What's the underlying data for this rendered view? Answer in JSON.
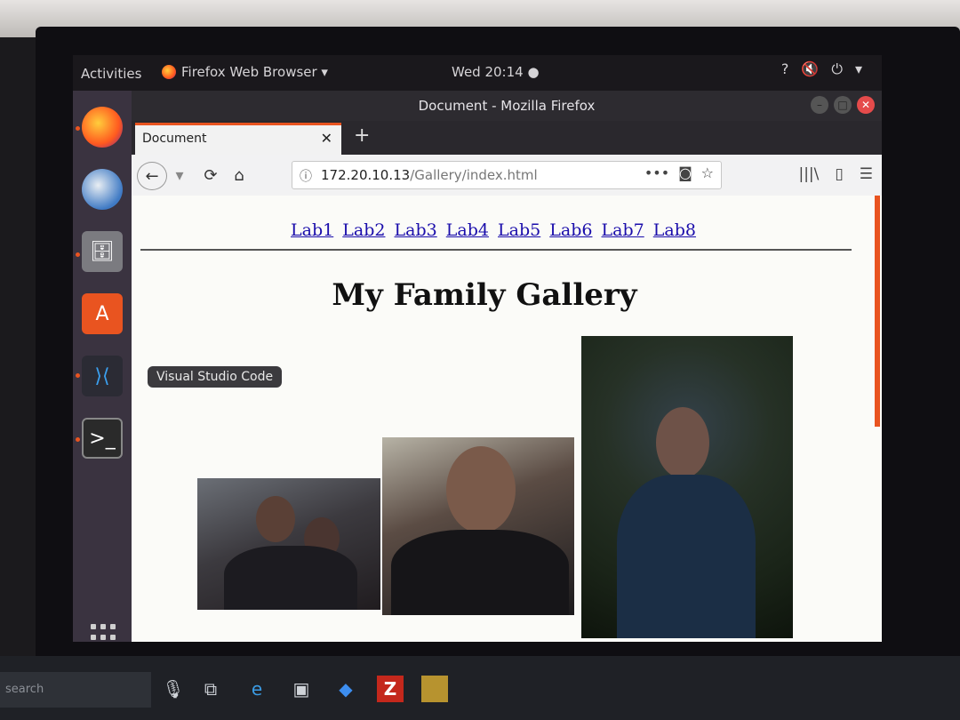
{
  "ubuntu": {
    "activities": "Activities",
    "app_menu": "Firefox Web Browser ▾",
    "clock": "Wed 20:14 ●",
    "dock_tooltip": "Visual Studio Code"
  },
  "window": {
    "title": "Document - Mozilla Firefox"
  },
  "tab": {
    "title": "Document",
    "close": "✕",
    "new_tab": "+"
  },
  "urlbar": {
    "host": "172.20.10.13",
    "path": "/Gallery/index.html",
    "more": "•••"
  },
  "page": {
    "nav_links": [
      "Lab1",
      "Lab2",
      "Lab3",
      "Lab4",
      "Lab5",
      "Lab6",
      "Lab7",
      "Lab8"
    ],
    "title": "My Family Gallery"
  },
  "host_taskbar": {
    "search": "search"
  },
  "icons": {
    "back": "back-arrow-icon",
    "reload": "reload-icon",
    "home": "home-icon",
    "pocket": "pocket-icon",
    "bookmark": "star-icon",
    "library": "library-icon",
    "sidebar": "sidebar-icon",
    "menu": "hamburger-menu-icon"
  },
  "colors": {
    "ubuntu_orange": "#e95420",
    "link": "#1a0dab"
  }
}
